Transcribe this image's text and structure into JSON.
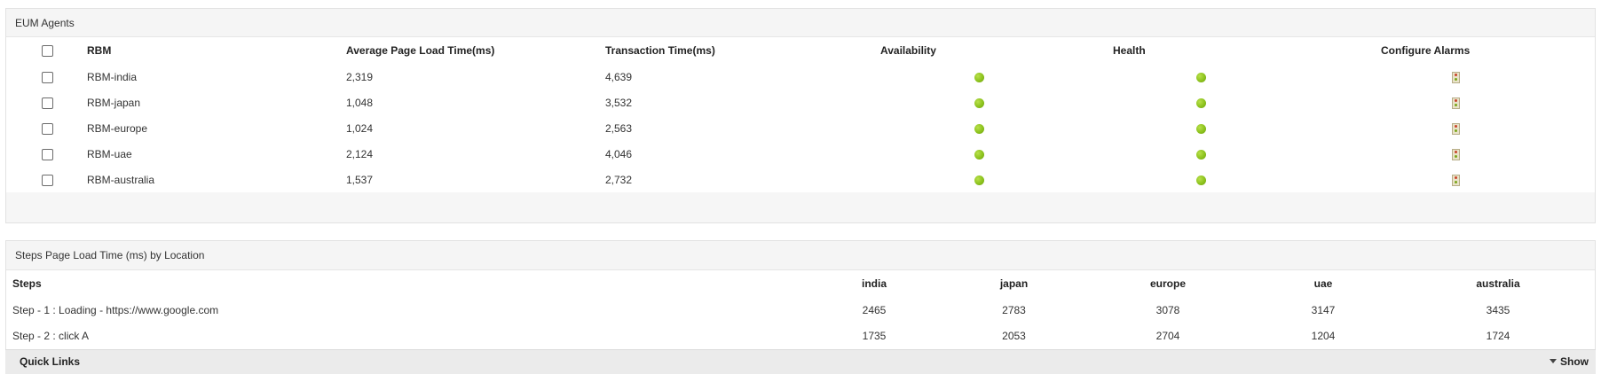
{
  "agents_panel": {
    "title": "EUM Agents",
    "columns": {
      "name": "RBM",
      "avg_page_load": "Average Page Load Time(ms)",
      "transaction_time": "Transaction Time(ms)",
      "availability": "Availability",
      "health": "Health",
      "configure_alarms": "Configure Alarms"
    },
    "rows": [
      {
        "name": "RBM-india",
        "avg_page_load": "2,319",
        "transaction_time": "4,639",
        "availability": "up",
        "health": "clear"
      },
      {
        "name": "RBM-japan",
        "avg_page_load": "1,048",
        "transaction_time": "3,532",
        "availability": "up",
        "health": "clear"
      },
      {
        "name": "RBM-europe",
        "avg_page_load": "1,024",
        "transaction_time": "2,563",
        "availability": "up",
        "health": "clear"
      },
      {
        "name": "RBM-uae",
        "avg_page_load": "2,124",
        "transaction_time": "4,046",
        "availability": "up",
        "health": "clear"
      },
      {
        "name": "RBM-australia",
        "avg_page_load": "1,537",
        "transaction_time": "2,732",
        "availability": "up",
        "health": "clear"
      }
    ],
    "status_color": "#8cc21d"
  },
  "steps_panel": {
    "title": "Steps Page Load Time (ms) by Location",
    "columns": {
      "steps": "Steps",
      "india": "india",
      "japan": "japan",
      "europe": "europe",
      "uae": "uae",
      "australia": "australia"
    },
    "rows": [
      {
        "step": "Step - 1 : Loading - https://www.google.com",
        "india": "2465",
        "japan": "2783",
        "europe": "3078",
        "uae": "3147",
        "australia": "3435"
      },
      {
        "step": "Step - 2 : click A",
        "india": "1735",
        "japan": "2053",
        "europe": "2704",
        "uae": "1204",
        "australia": "1724"
      }
    ]
  },
  "quick_links": {
    "title": "Quick Links",
    "toggle_label": "Show",
    "toggle_icon": "caret-down-icon"
  }
}
